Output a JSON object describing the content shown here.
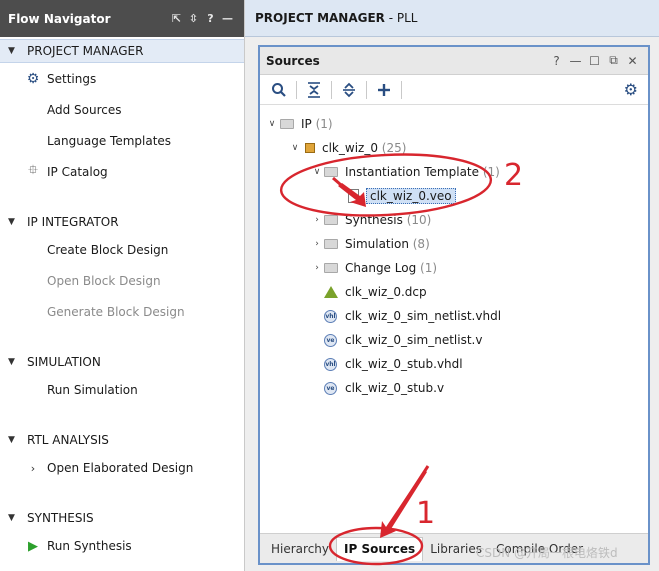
{
  "navigator": {
    "title": "Flow Navigator",
    "controls": [
      "⇱",
      "⇳",
      "?",
      "—"
    ],
    "sections": [
      {
        "label": "PROJECT MANAGER",
        "items": [
          "Settings",
          "Add Sources",
          "Language Templates",
          "IP Catalog"
        ]
      },
      {
        "label": "IP INTEGRATOR",
        "items": [
          "Create Block Design",
          "Open Block Design",
          "Generate Block Design"
        ]
      },
      {
        "label": "SIMULATION",
        "items": [
          "Run Simulation"
        ]
      },
      {
        "label": "RTL ANALYSIS",
        "items": [
          "Open Elaborated Design"
        ]
      },
      {
        "label": "SYNTHESIS",
        "items": [
          "Run Synthesis"
        ]
      }
    ]
  },
  "project_bar": {
    "title": "PROJECT MANAGER",
    "suffix": " - PLL"
  },
  "sources": {
    "title": "Sources",
    "controls": [
      "?",
      "—",
      "☐",
      "⧉",
      "✕"
    ],
    "tree": [
      {
        "name": "IP",
        "count": "(1)"
      },
      {
        "name": "clk_wiz_0",
        "count": "(25)"
      },
      {
        "name": "Instantiation Template",
        "count": "(1)"
      },
      {
        "name": "clk_wiz_0.veo",
        "count": ""
      },
      {
        "name": "Synthesis",
        "count": "(10)"
      },
      {
        "name": "Simulation",
        "count": "(8)"
      },
      {
        "name": "Change Log",
        "count": "(1)"
      },
      {
        "name": "clk_wiz_0.dcp",
        "count": ""
      },
      {
        "name": "clk_wiz_0_sim_netlist.vhdl",
        "count": ""
      },
      {
        "name": "clk_wiz_0_sim_netlist.v",
        "count": ""
      },
      {
        "name": "clk_wiz_0_stub.vhdl",
        "count": ""
      },
      {
        "name": "clk_wiz_0_stub.v",
        "count": ""
      }
    ],
    "tabs": [
      "Hierarchy",
      "IP Sources",
      "Libraries",
      "Compile Order"
    ],
    "active_tab": "IP Sources"
  },
  "annotations": [
    "1",
    "2"
  ],
  "watermark": "CSDN @开局一根电烙铁d",
  "colors": {
    "accent": "#2a4e82",
    "annotation": "#d8262e",
    "run_green": "#2ca02c"
  }
}
